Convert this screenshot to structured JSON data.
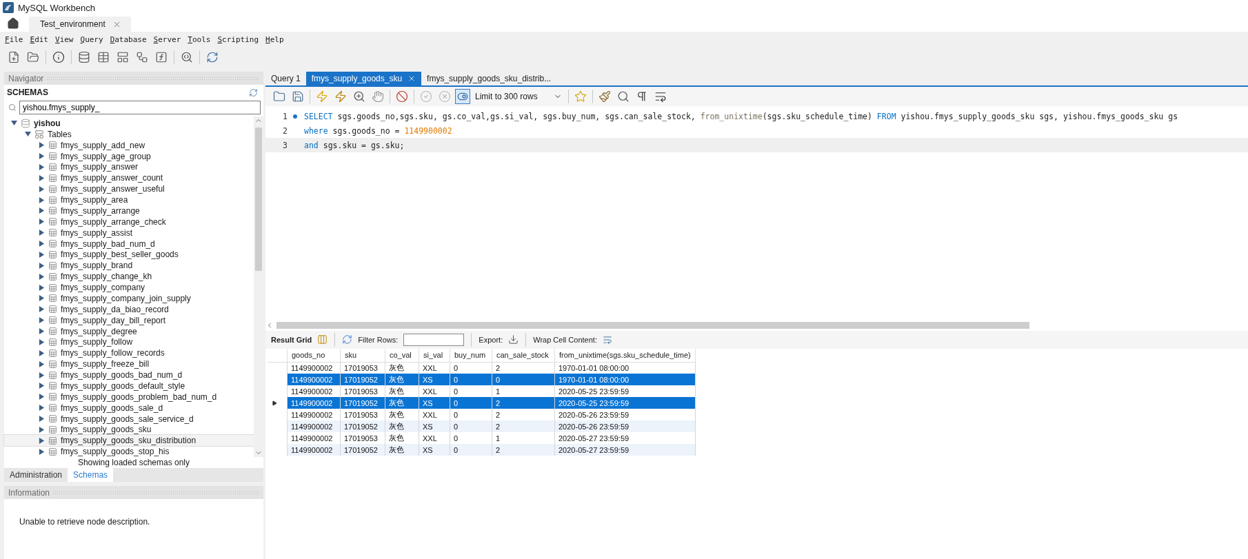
{
  "window": {
    "title": "MySQL Workbench"
  },
  "connection_tabs": [
    {
      "label": "Test_environment",
      "selected": true
    }
  ],
  "menu": [
    "File",
    "Edit",
    "View",
    "Query",
    "Database",
    "Server",
    "Tools",
    "Scripting",
    "Help"
  ],
  "navigator": {
    "title": "Navigator",
    "schemas_title": "SCHEMAS",
    "search": {
      "value": "yishou.fmys_supply_"
    },
    "tree": [
      {
        "label": "yishou",
        "kind": "schema",
        "expanded": true,
        "children": [
          {
            "label": "Tables",
            "kind": "folder",
            "expanded": true,
            "children": [
              {
                "label": "fmys_supply_add_new",
                "kind": "table",
                "expanded": false,
                "selected": false
              },
              {
                "label": "fmys_supply_age_group",
                "kind": "table",
                "expanded": false,
                "selected": false
              },
              {
                "label": "fmys_supply_answer",
                "kind": "table",
                "expanded": false,
                "selected": false
              },
              {
                "label": "fmys_supply_answer_count",
                "kind": "table",
                "expanded": false,
                "selected": false
              },
              {
                "label": "fmys_supply_answer_useful",
                "kind": "table",
                "expanded": false,
                "selected": false
              },
              {
                "label": "fmys_supply_area",
                "kind": "table",
                "expanded": false,
                "selected": false
              },
              {
                "label": "fmys_supply_arrange",
                "kind": "table",
                "expanded": false,
                "selected": false
              },
              {
                "label": "fmys_supply_arrange_check",
                "kind": "table",
                "expanded": false,
                "selected": false
              },
              {
                "label": "fmys_supply_assist",
                "kind": "table",
                "expanded": false,
                "selected": false
              },
              {
                "label": "fmys_supply_bad_num_d",
                "kind": "table",
                "expanded": false,
                "selected": false
              },
              {
                "label": "fmys_supply_best_seller_goods",
                "kind": "table",
                "expanded": false,
                "selected": false
              },
              {
                "label": "fmys_supply_brand",
                "kind": "table",
                "expanded": false,
                "selected": false
              },
              {
                "label": "fmys_supply_change_kh",
                "kind": "table",
                "expanded": false,
                "selected": false
              },
              {
                "label": "fmys_supply_company",
                "kind": "table",
                "expanded": false,
                "selected": false
              },
              {
                "label": "fmys_supply_company_join_supply",
                "kind": "table",
                "expanded": false,
                "selected": false
              },
              {
                "label": "fmys_supply_da_biao_record",
                "kind": "table",
                "expanded": false,
                "selected": false
              },
              {
                "label": "fmys_supply_day_bill_report",
                "kind": "table",
                "expanded": false,
                "selected": false
              },
              {
                "label": "fmys_supply_degree",
                "kind": "table",
                "expanded": false,
                "selected": false
              },
              {
                "label": "fmys_supply_follow",
                "kind": "table",
                "expanded": false,
                "selected": false
              },
              {
                "label": "fmys_supply_follow_records",
                "kind": "table",
                "expanded": false,
                "selected": false
              },
              {
                "label": "fmys_supply_freeze_bill",
                "kind": "table",
                "expanded": false,
                "selected": false
              },
              {
                "label": "fmys_supply_goods_bad_num_d",
                "kind": "table",
                "expanded": false,
                "selected": false
              },
              {
                "label": "fmys_supply_goods_default_style",
                "kind": "table",
                "expanded": false,
                "selected": false
              },
              {
                "label": "fmys_supply_goods_problem_bad_num_d",
                "kind": "table",
                "expanded": false,
                "selected": false
              },
              {
                "label": "fmys_supply_goods_sale_d",
                "kind": "table",
                "expanded": false,
                "selected": false
              },
              {
                "label": "fmys_supply_goods_sale_service_d",
                "kind": "table",
                "expanded": false,
                "selected": false
              },
              {
                "label": "fmys_supply_goods_sku",
                "kind": "table",
                "expanded": false,
                "selected": false
              },
              {
                "label": "fmys_supply_goods_sku_distribution",
                "kind": "table",
                "expanded": false,
                "selected": true
              },
              {
                "label": "fmys_supply_goods_stop_his",
                "kind": "table",
                "expanded": false,
                "selected": false
              }
            ]
          }
        ]
      }
    ],
    "footer": "Showing loaded schemas only",
    "tabs": [
      {
        "label": "Administration",
        "selected": false
      },
      {
        "label": "Schemas",
        "selected": true
      }
    ]
  },
  "information": {
    "title": "Information",
    "text": "Unable to retrieve node description."
  },
  "query_tabs": [
    {
      "label": "Query 1",
      "selected": false
    },
    {
      "label": "fmys_supply_goods_sku",
      "selected": true
    },
    {
      "label": "fmys_supply_goods_sku_distrib...",
      "selected": false
    }
  ],
  "editor_toolbar": {
    "limit": "Limit to 300 rows",
    "autocommit_on": true,
    "transaction_disabled": true
  },
  "editor": {
    "lines": [
      {
        "number": "1",
        "marker": true,
        "current": false,
        "tokens": [
          {
            "text": "SELECT",
            "kind": "keyword"
          },
          {
            "text": " sgs.goods_no,sgs.sku, gs.co_val,gs.si_val, sgs.buy_num, sgs.can_sale_stock, ",
            "kind": "plain"
          },
          {
            "text": "from_unixtime",
            "kind": "function"
          },
          {
            "text": "(sgs.sku_schedule_time) ",
            "kind": "plain"
          },
          {
            "text": "FROM",
            "kind": "keyword"
          },
          {
            "text": " yishou.fmys_supply_goods_sku sgs, yishou.fmys_goods_sku gs",
            "kind": "plain"
          }
        ]
      },
      {
        "number": "2",
        "marker": false,
        "current": false,
        "tokens": [
          {
            "text": "where",
            "kind": "keyword"
          },
          {
            "text": " sgs.goods_no = ",
            "kind": "plain"
          },
          {
            "text": "1149900002",
            "kind": "number"
          }
        ]
      },
      {
        "number": "3",
        "marker": false,
        "current": true,
        "tokens": [
          {
            "text": "and",
            "kind": "keyword"
          },
          {
            "text": " sgs.sku = gs.sku;",
            "kind": "plain"
          }
        ]
      }
    ]
  },
  "result_toolbar": {
    "view": "Result Grid",
    "filter_label": "Filter Rows:",
    "export_label": "Export:",
    "wrap_label": "Wrap Cell Content:"
  },
  "result_grid": {
    "columns": [
      "goods_no",
      "sku",
      "co_val",
      "si_val",
      "buy_num",
      "can_sale_stock",
      "from_unixtime(sgs.sku_schedule_time)"
    ],
    "rows": [
      {
        "cells": [
          "1149900002",
          "17019053",
          "灰色",
          "XXL",
          "0",
          "2",
          "1970-01-01 08:00:00"
        ],
        "selected": false,
        "current": false
      },
      {
        "cells": [
          "1149900002",
          "17019052",
          "灰色",
          "XS",
          "0",
          "0",
          "1970-01-01 08:00:00"
        ],
        "selected": true,
        "current": false
      },
      {
        "cells": [
          "1149900002",
          "17019053",
          "灰色",
          "XXL",
          "0",
          "1",
          "2020-05-25 23:59:59"
        ],
        "selected": false,
        "current": false
      },
      {
        "cells": [
          "1149900002",
          "17019052",
          "灰色",
          "XS",
          "0",
          "2",
          "2020-05-25 23:59:59"
        ],
        "selected": true,
        "current": true
      },
      {
        "cells": [
          "1149900002",
          "17019053",
          "灰色",
          "XXL",
          "0",
          "2",
          "2020-05-26 23:59:59"
        ],
        "selected": false,
        "current": false
      },
      {
        "cells": [
          "1149900002",
          "17019052",
          "灰色",
          "XS",
          "0",
          "2",
          "2020-05-26 23:59:59"
        ],
        "selected": false,
        "current": false
      },
      {
        "cells": [
          "1149900002",
          "17019053",
          "灰色",
          "XXL",
          "0",
          "1",
          "2020-05-27 23:59:59"
        ],
        "selected": false,
        "current": false
      },
      {
        "cells": [
          "1149900002",
          "17019052",
          "灰色",
          "XS",
          "0",
          "2",
          "2020-05-27 23:59:59"
        ],
        "selected": false,
        "current": false
      }
    ]
  }
}
